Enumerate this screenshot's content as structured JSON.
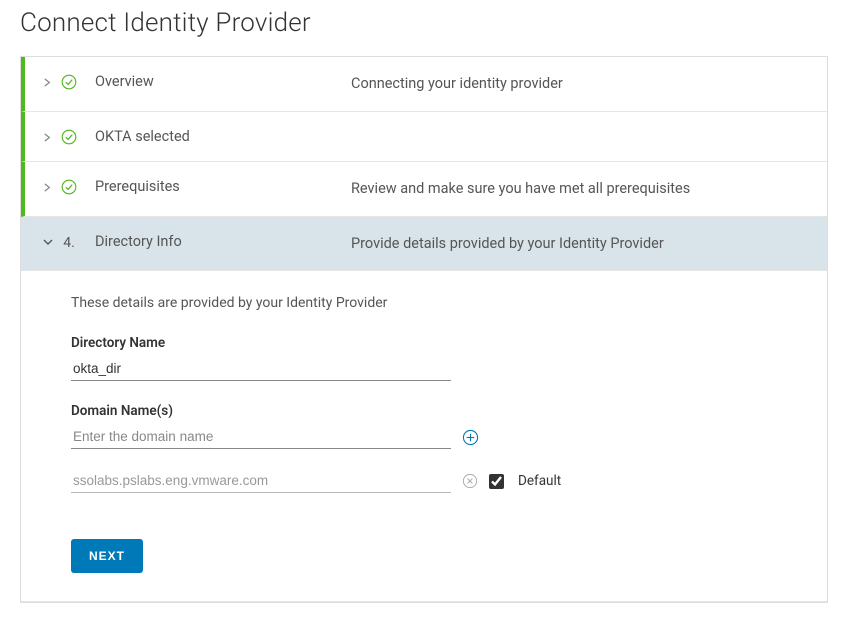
{
  "page": {
    "title": "Connect Identity Provider"
  },
  "steps": [
    {
      "title": "Overview",
      "desc": "Connecting your identity provider"
    },
    {
      "title": "OKTA selected",
      "desc": ""
    },
    {
      "title": "Prerequisites",
      "desc": "Review and make sure you have met all prerequisites"
    },
    {
      "title": "Directory Info",
      "desc": "Provide details provided by your Identity Provider"
    }
  ],
  "active_step_number": "4.",
  "body": {
    "intro": "These details are provided by your Identity Provider",
    "directory_name_label": "Directory Name",
    "directory_name_value": "okta_dir",
    "domain_names_label": "Domain Name(s)",
    "domain_input_placeholder": "Enter the domain name",
    "domain_entries": [
      {
        "value": "ssolabs.pslabs.eng.vmware.com",
        "default": true
      }
    ],
    "default_label": "Default",
    "next_button": "NEXT"
  },
  "colors": {
    "accent_green": "#4fb81c",
    "accent_blue": "#0079b8",
    "active_bg": "#d9e4ea"
  }
}
